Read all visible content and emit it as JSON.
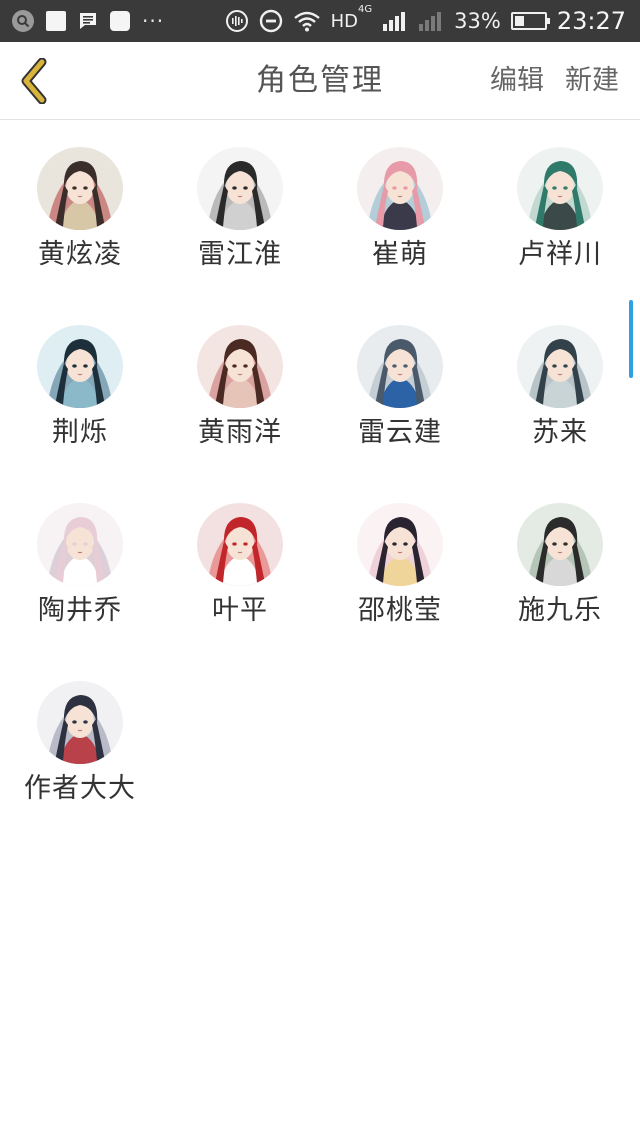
{
  "status_bar": {
    "more_dots": "···",
    "network": "HD",
    "network_sup": "4G",
    "battery_text": "33%",
    "battery_level": 0.33,
    "time": "23:27",
    "icons": [
      "search-icon",
      "square-icon",
      "message-icon",
      "app-icon",
      "nfc-icon",
      "dnd-icon",
      "wifi-icon",
      "signal-icon"
    ]
  },
  "header": {
    "title": "角色管理",
    "edit_label": "编辑",
    "new_label": "新建",
    "accent": "#d9b43a"
  },
  "characters": [
    {
      "name": "黄炫凌",
      "palette": [
        "#e9e4dc",
        "#3b2e2a",
        "#b23a3a",
        "#d8c7a6"
      ]
    },
    {
      "name": "雷江淮",
      "palette": [
        "#f4f4f4",
        "#2a2a2a",
        "#8a8a8a",
        "#d0d0d0"
      ]
    },
    {
      "name": "崔萌",
      "palette": [
        "#f5eeee",
        "#e79aa8",
        "#7bb4c9",
        "#3a3a4a"
      ]
    },
    {
      "name": "卢祥川",
      "palette": [
        "#eef3f1",
        "#2f7a6a",
        "#9cc3b5",
        "#3b4a48"
      ]
    },
    {
      "name": "荆烁",
      "palette": [
        "#dfeef2",
        "#1c2f3a",
        "#3b6e86",
        "#8bb9c9"
      ]
    },
    {
      "name": "黄雨洋",
      "palette": [
        "#f3e6e2",
        "#4a2a22",
        "#c56b6b",
        "#e7c4b8"
      ]
    },
    {
      "name": "雷云建",
      "palette": [
        "#e8ecef",
        "#4a5a6a",
        "#a7b4bf",
        "#2c62a6"
      ]
    },
    {
      "name": "苏来",
      "palette": [
        "#eef2f3",
        "#33424a",
        "#8d9fa6",
        "#c9d4d6"
      ]
    },
    {
      "name": "陶井乔",
      "palette": [
        "#f7f2f4",
        "#e8cdd6",
        "#c9b3c0",
        "#ffffff"
      ]
    },
    {
      "name": "叶平",
      "palette": [
        "#f3e1e1",
        "#c0262a",
        "#e25e5e",
        "#ffffff"
      ]
    },
    {
      "name": "邵桃莹",
      "palette": [
        "#fbf3f3",
        "#2a2430",
        "#e6b7c3",
        "#f0d59a"
      ]
    },
    {
      "name": "施九乐",
      "palette": [
        "#e3ebe4",
        "#2b2b2b",
        "#8fa694",
        "#d8d8d8"
      ]
    },
    {
      "name": "作者大大",
      "palette": [
        "#f1f1f3",
        "#2d3140",
        "#8a8fa4",
        "#b9414a"
      ]
    }
  ]
}
